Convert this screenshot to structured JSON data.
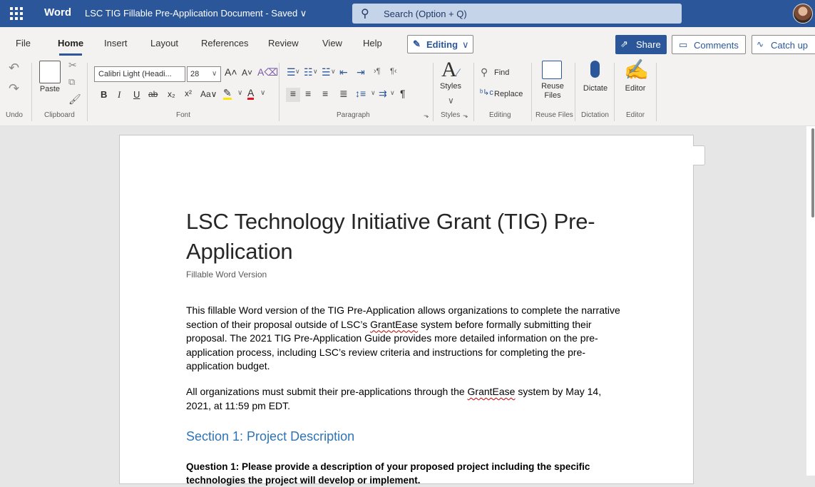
{
  "titlebar": {
    "app_name": "Word",
    "doc_title": "LSC TIG Fillable Pre-Application Document  -  Saved ∨",
    "search_placeholder": "Search (Option + Q)"
  },
  "tabs": [
    "File",
    "Home",
    "Insert",
    "Layout",
    "References",
    "Review",
    "View",
    "Help"
  ],
  "mode_button": "Editing",
  "share_label": "Share",
  "comments_label": "Comments",
  "catchup_label": "Catch up",
  "ribbon": {
    "undo_label": "Undo",
    "clipboard_label": "Clipboard",
    "paste_label": "Paste",
    "font_name": "Calibri Light (Headi...",
    "font_size": "28",
    "font_label": "Font",
    "paragraph_label": "Paragraph",
    "styles_label": "Styles",
    "styles_group_label": "Styles",
    "find_label": "Find",
    "replace_label": "Replace",
    "editing_label": "Editing",
    "reuse_files_btn": "Reuse Files",
    "reuse_files_label": "Reuse Files",
    "dictate_btn": "Dictate",
    "dictation_label": "Dictation",
    "editor_btn": "Editor",
    "editor_label": "Editor"
  },
  "document": {
    "title": "LSC Technology Initiative Grant (TIG) Pre-Application",
    "subtitle": "Fillable Word Version",
    "p1_a": "This fillable Word version of the TIG Pre-Application allows organizations to complete the narrative section of their proposal outside of LSC’s ",
    "p1_squig": "GrantEase",
    "p1_b": " system before formally submitting their proposal. The 2021 TIG Pre-Application Guide provides more detailed information on the pre-application process, including LSC’s review criteria and instructions for completing the pre-application budget.",
    "p2_a": "All organizations must submit their pre-applications through the ",
    "p2_squig": "GrantEase",
    "p2_b": " system by May 14, 2021, at 11:59 pm EDT.",
    "section1": "Section 1: Project Description",
    "question1": "Question 1: Please provide a description of your proposed project including the specific technologies the project will develop or implement."
  }
}
